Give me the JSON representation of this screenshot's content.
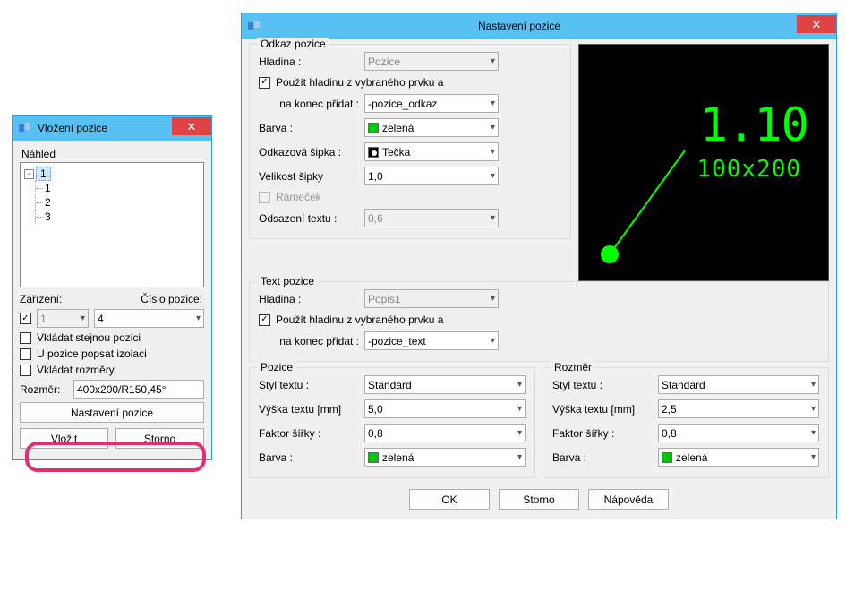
{
  "small": {
    "title": "Vložení pozice",
    "tree_label": "Náhled",
    "tree_root": "1",
    "tree_items": [
      "1",
      "2",
      "3"
    ],
    "zarizeni_label": "Zařízení:",
    "zarizeni_value": "1",
    "cislo_label": "Číslo pozice:",
    "cislo_value": "4",
    "chk1": "Vkládat stejnou pozici",
    "chk2": "U pozice popsat izolaci",
    "chk3": "Vkládat rozměry",
    "rozmer_label": "Rozměr:",
    "rozmer_value": "400x200/R150,45°",
    "btn_nastaveni": "Nastavení pozice",
    "btn_vlozit": "Vložit",
    "btn_storno": "Storno"
  },
  "large": {
    "title": "Nastavení pozice",
    "odkaz": {
      "legend": "Odkaz pozice",
      "hladina_label": "Hladina :",
      "hladina_value": "Pozice",
      "use_layer": "Použít hladinu z vybraného prvku a",
      "append_label": "na konec přidat :",
      "append_value": "-pozice_odkaz",
      "barva_label": "Barva :",
      "barva_value": "zelená",
      "sipka_label": "Odkazová šipka :",
      "sipka_value": "Tečka",
      "vel_label": "Velikost šipky",
      "vel_value": "1,0",
      "ramecek": "Rámeček",
      "odsaz_label": "Odsazení textu :",
      "odsaz_value": "0,6"
    },
    "text": {
      "legend": "Text pozice",
      "hladina_label": "Hladina :",
      "hladina_value": "Popis1",
      "use_layer": "Použít hladinu z vybraného prvku a",
      "append_label": "na konec přidat :",
      "append_value": "-pozice_text"
    },
    "pozice": {
      "legend": "Pozice",
      "styl_label": "Styl textu :",
      "styl_value": "Standard",
      "vyska_label": "Výška textu [mm]",
      "vyska_value": "5,0",
      "faktor_label": "Faktor šířky :",
      "faktor_value": "0,8",
      "barva_label": "Barva :",
      "barva_value": "zelená"
    },
    "rozmer": {
      "legend": "Rozměr",
      "styl_label": "Styl textu :",
      "styl_value": "Standard",
      "vyska_label": "Výška textu [mm]",
      "vyska_value": "2,5",
      "faktor_label": "Faktor šířky :",
      "faktor_value": "0,8",
      "barva_label": "Barva :",
      "barva_value": "zelená"
    },
    "preview": {
      "big": "1.10",
      "sub": "100x200"
    },
    "btn_ok": "OK",
    "btn_storno": "Storno",
    "btn_help": "Nápověda"
  }
}
